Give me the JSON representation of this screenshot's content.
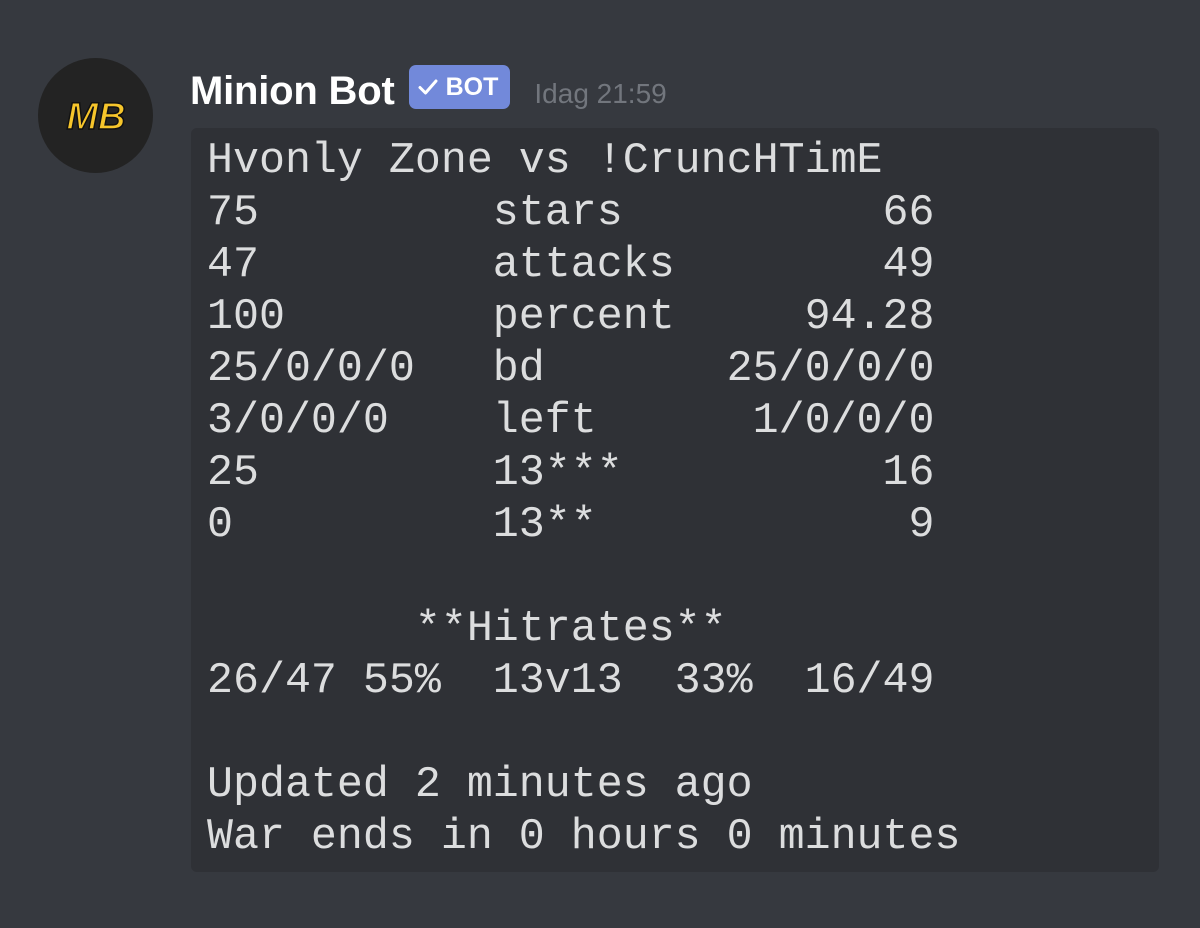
{
  "message": {
    "author": {
      "name": "Minion Bot",
      "avatar_text": "MB",
      "bot_badge": "BOT",
      "badge_icon": "checkmark-icon"
    },
    "timestamp": "Idag 21:59",
    "code_lines": [
      "Hvonly Zone vs !CruncHTimE",
      "75         stars          66",
      "47         attacks        49",
      "100        percent     94.28",
      "25/0/0/0   bd       25/0/0/0",
      "3/0/0/0    left      1/0/0/0",
      "25         13***          16",
      "0          13**            9",
      "",
      "        **Hitrates**",
      "26/47 55%  13v13  33%  16/49",
      "",
      "Updated 2 minutes ago",
      "War ends in 0 hours 0 minutes"
    ]
  },
  "colors": {
    "background": "#36393f",
    "codeblock_background": "#2f3136",
    "bot_badge": "#7289da",
    "avatar_accent": "#f6c52b"
  }
}
